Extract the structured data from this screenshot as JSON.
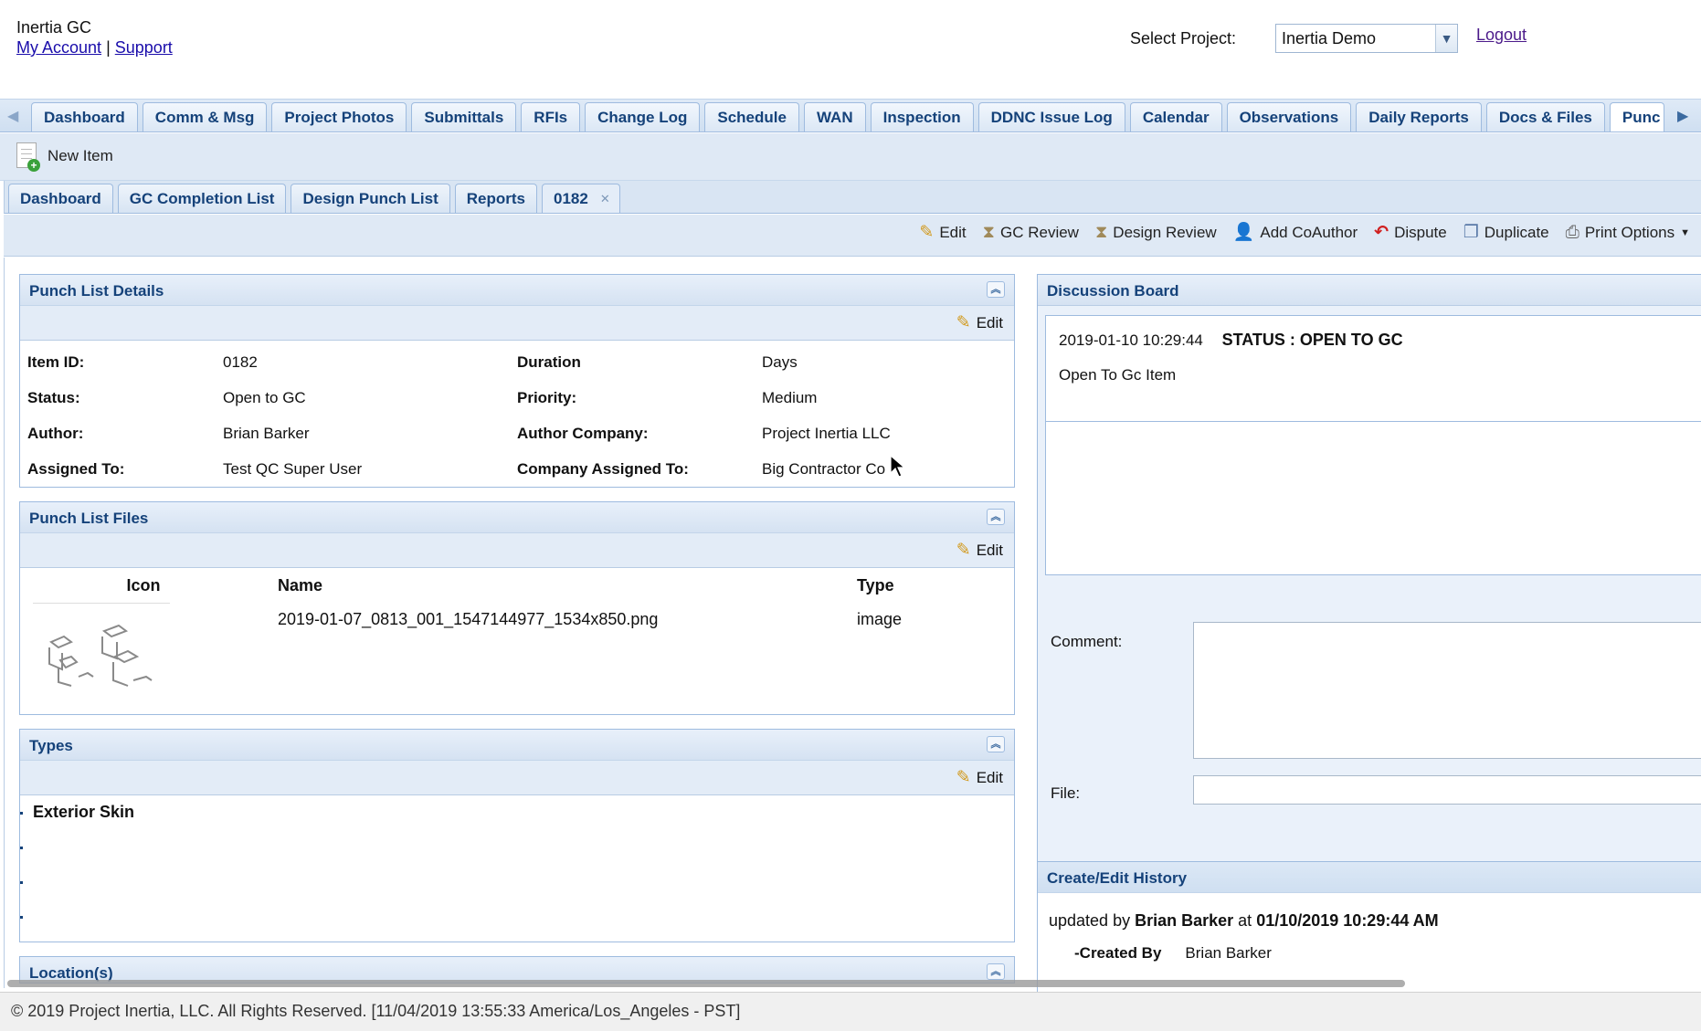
{
  "header": {
    "company": "Inertia GC",
    "my_account": "My Account",
    "separator": "|",
    "support": "Support",
    "select_project_label": "Select Project:",
    "project_value": "Inertia Demo",
    "logout": "Logout"
  },
  "main_tabs": [
    "Dashboard",
    "Comm & Msg",
    "Project Photos",
    "Submittals",
    "RFIs",
    "Change Log",
    "Schedule",
    "WAN",
    "Inspection",
    "DDNC Issue Log",
    "Calendar",
    "Observations",
    "Daily Reports",
    "Docs & Files",
    "Punc"
  ],
  "toolbar": {
    "new_item": "New Item"
  },
  "sub_tabs": [
    "Dashboard",
    "GC Completion List",
    "Design Punch List",
    "Reports",
    "0182"
  ],
  "actions": {
    "edit": "Edit",
    "gc_review": "GC Review",
    "design_review": "Design Review",
    "add_coauthor": "Add CoAuthor",
    "dispute": "Dispute",
    "duplicate": "Duplicate",
    "print_options": "Print Options"
  },
  "details": {
    "title": "Punch List Details",
    "edit": "Edit",
    "rows": [
      {
        "l1": "Item ID:",
        "v1": "0182",
        "l2": "Duration",
        "v2": "Days"
      },
      {
        "l1": "Status:",
        "v1": "Open to GC",
        "l2": "Priority:",
        "v2": "Medium"
      },
      {
        "l1": "Author:",
        "v1": "Brian Barker",
        "l2": "Author Company:",
        "v2": "Project Inertia LLC"
      },
      {
        "l1": "Assigned To:",
        "v1": "Test QC Super User",
        "l2": "Company Assigned To:",
        "v2": "Big Contractor Co"
      }
    ]
  },
  "files": {
    "title": "Punch List Files",
    "edit": "Edit",
    "columns": [
      "Icon",
      "Name",
      "Type"
    ],
    "rows": [
      {
        "name": "2019-01-07_0813_001_1547144977_1534x850.png",
        "type": "image"
      }
    ]
  },
  "types": {
    "title": "Types",
    "edit": "Edit",
    "items": [
      "Exterior Skin"
    ]
  },
  "locations": {
    "title": "Location(s)"
  },
  "discussion": {
    "title": "Discussion Board",
    "entry": {
      "timestamp": "2019-01-10 10:29:44",
      "status": "STATUS : OPEN TO GC",
      "message": "Open To Gc Item"
    },
    "comment_label": "Comment:",
    "file_label": "File:"
  },
  "history": {
    "title": "Create/Edit History",
    "prefix": "updated by",
    "user": "Brian Barker",
    "at": "at",
    "datetime": "01/10/2019 10:29:44 AM",
    "created_by_label": "-Created By",
    "created_by": "Brian Barker"
  },
  "footer": {
    "text": "© 2019 Project Inertia, LLC. All Rights Reserved. [11/04/2019 13:55:33 America/Los_Angeles - PST]"
  }
}
